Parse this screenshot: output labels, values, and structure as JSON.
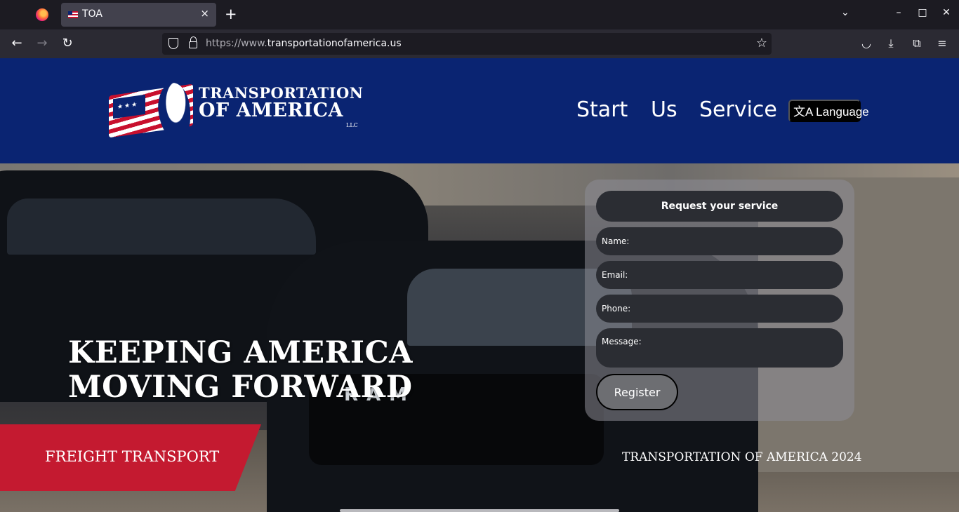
{
  "browser": {
    "tab_title": "TOA",
    "tab_close": "×",
    "new_tab": "+",
    "list_tabs": "⌄",
    "minimize": "–",
    "maximize": "□",
    "close": "✕",
    "url_prefix": "https://www.",
    "url_domain": "transportationofamerica.us",
    "back": "←",
    "forward": "→",
    "reload": "↻",
    "star": "☆",
    "pocket": "◡",
    "downloads": "⤓",
    "extensions": "⧉",
    "menu": "≡"
  },
  "logo": {
    "line1": "TRANSPORTATION",
    "line2": "OF AMERICA",
    "llc": "LLC",
    "stars": "★★★"
  },
  "nav": {
    "start": "Start",
    "us": "Us",
    "service": "Service",
    "language": "文A Language"
  },
  "hero": {
    "heading_line1": "KEEPING AMERICA",
    "heading_line2": "MOVING FORWARD",
    "truck_brand": "RAM"
  },
  "form": {
    "title": "Request your service",
    "name_placeholder": "Name:",
    "email_placeholder": "Email:",
    "phone_placeholder": "Phone:",
    "message_placeholder": "Message:",
    "register_label": "Register"
  },
  "banner": {
    "freight": "FREIGHT TRANSPORT",
    "footer": "TRANSPORTATION OF AMERICA 2024"
  },
  "colors": {
    "header_blue": "#0a2472",
    "banner_red": "#c41a30"
  }
}
